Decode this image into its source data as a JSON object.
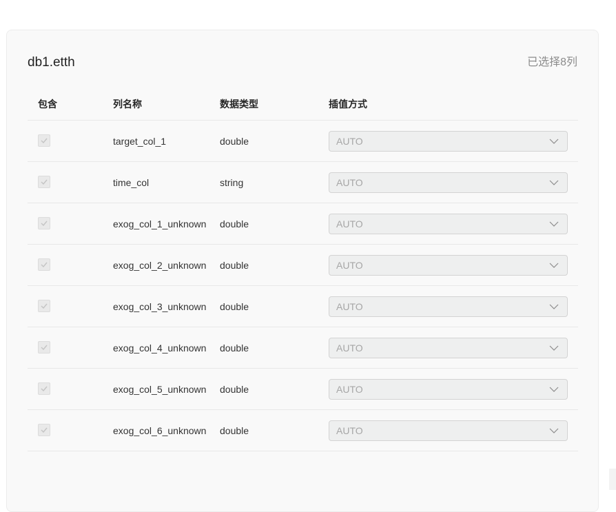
{
  "panel": {
    "title": "db1.etth",
    "selected_count": "已选择8列"
  },
  "table": {
    "headers": {
      "include": "包含",
      "column_name": "列名称",
      "data_type": "数据类型",
      "interpolation": "插值方式"
    },
    "rows": [
      {
        "name": "target_col_1",
        "type": "double",
        "interpolation": "AUTO",
        "included": true
      },
      {
        "name": "time_col",
        "type": "string",
        "interpolation": "AUTO",
        "included": true
      },
      {
        "name": "exog_col_1_unknown",
        "type": "double",
        "interpolation": "AUTO",
        "included": true
      },
      {
        "name": "exog_col_2_unknown",
        "type": "double",
        "interpolation": "AUTO",
        "included": true
      },
      {
        "name": "exog_col_3_unknown",
        "type": "double",
        "interpolation": "AUTO",
        "included": true
      },
      {
        "name": "exog_col_4_unknown",
        "type": "double",
        "interpolation": "AUTO",
        "included": true
      },
      {
        "name": "exog_col_5_unknown",
        "type": "double",
        "interpolation": "AUTO",
        "included": true
      },
      {
        "name": "exog_col_6_unknown",
        "type": "double",
        "interpolation": "AUTO",
        "included": true
      }
    ]
  },
  "icons": {
    "checkbox": "check-icon",
    "select": "chevron-down-icon"
  },
  "colors": {
    "panel_bg": "#f9f9f9",
    "disabled_text": "#a6a6a6",
    "divider": "#e8e8e8"
  }
}
